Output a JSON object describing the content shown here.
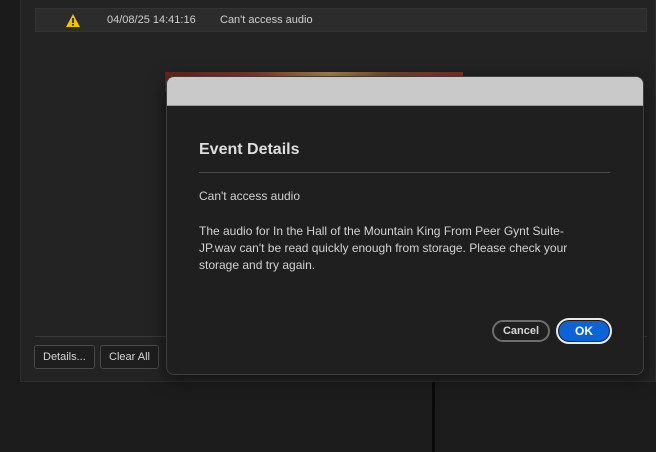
{
  "events": {
    "rows": [
      {
        "icon": "warning-icon",
        "timestamp": "04/08/25 14:41:16",
        "message": "Can't access audio"
      }
    ],
    "details_label": "Details...",
    "clear_all_label": "Clear All"
  },
  "dialog": {
    "title": "Event Details",
    "summary": "Can't access audio",
    "body": "The audio for In the Hall of the Mountain King From Peer Gynt Suite-JP.wav can't be read quickly enough from storage. Please check your storage and try again.",
    "cancel_label": "Cancel",
    "ok_label": "OK"
  },
  "colors": {
    "accent": "#0b63d6",
    "warning": "#f2c200",
    "titlebar": "#c9c9c9"
  }
}
